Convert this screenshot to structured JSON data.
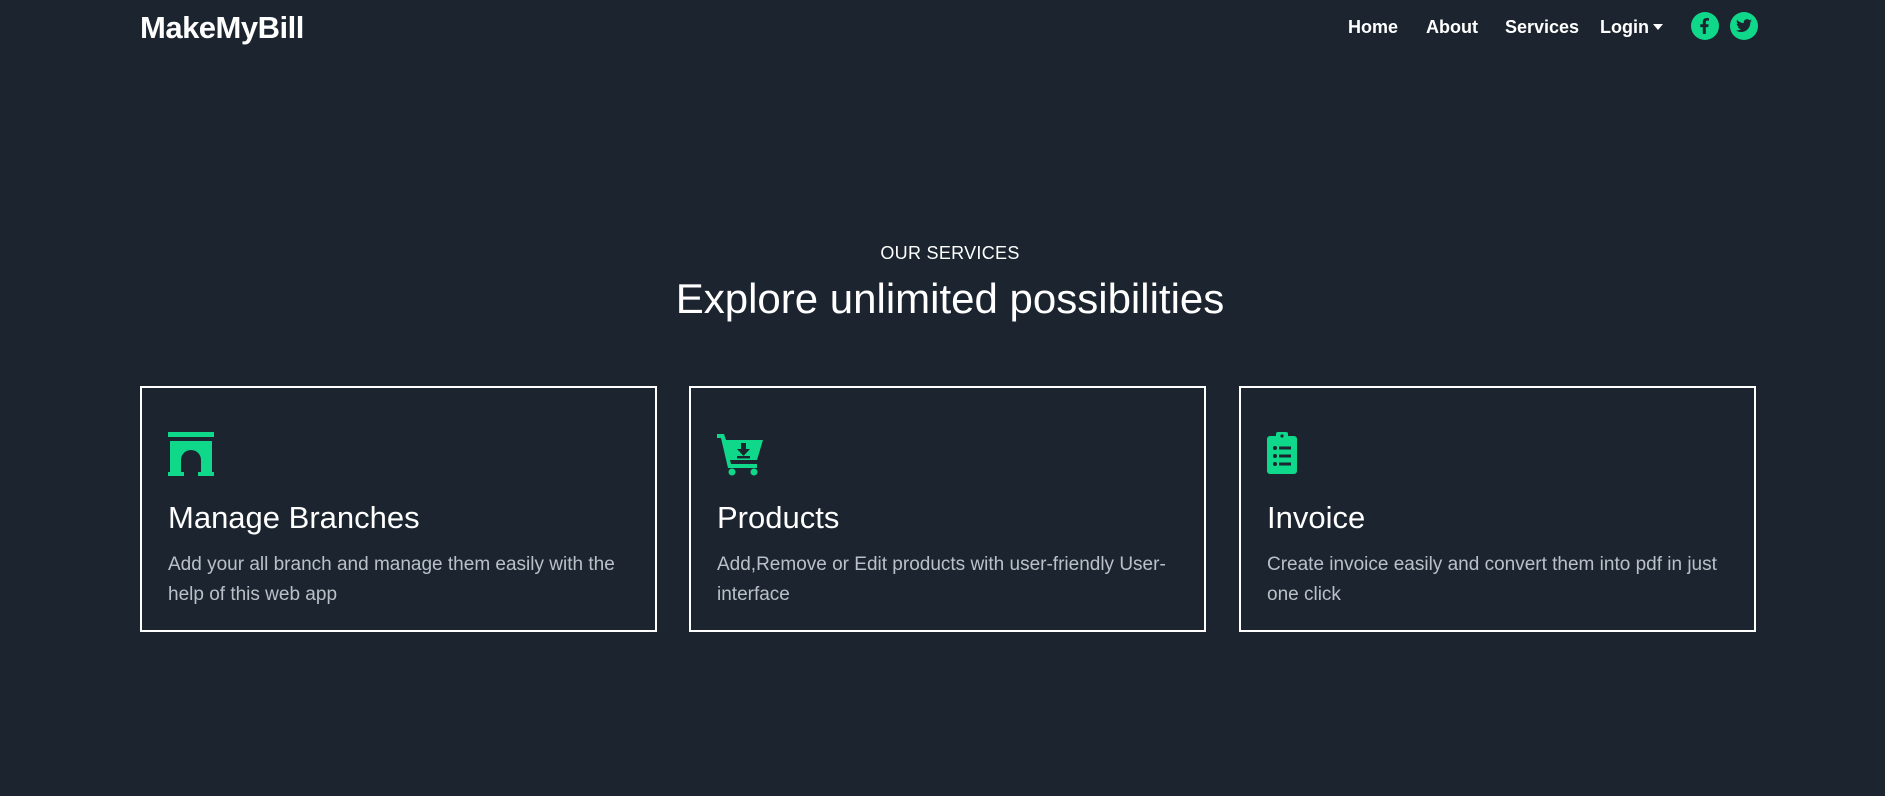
{
  "navbar": {
    "brand": "MakeMyBill",
    "links": {
      "home": "Home",
      "about": "About",
      "services": "Services",
      "login": "Login"
    },
    "social": [
      "facebook-icon",
      "twitter-icon"
    ]
  },
  "section": {
    "eyebrow": "OUR SERVICES",
    "headline": "Explore unlimited possibilities"
  },
  "cards": [
    {
      "icon": "archway-icon",
      "title": "Manage Branches",
      "text": "Add your all branch and manage them easily with the help of this web app"
    },
    {
      "icon": "cart-download-icon",
      "title": "Products",
      "text": "Add,Remove or Edit products with user-friendly User-interface"
    },
    {
      "icon": "clipboard-list-icon",
      "title": "Invoice",
      "text": "Create invoice easily and convert them into pdf in just one click"
    }
  ],
  "colors": {
    "background": "#1c252f",
    "accent": "#0fd88a",
    "text": "#ffffff",
    "muted_text": "#b9c0c8"
  }
}
